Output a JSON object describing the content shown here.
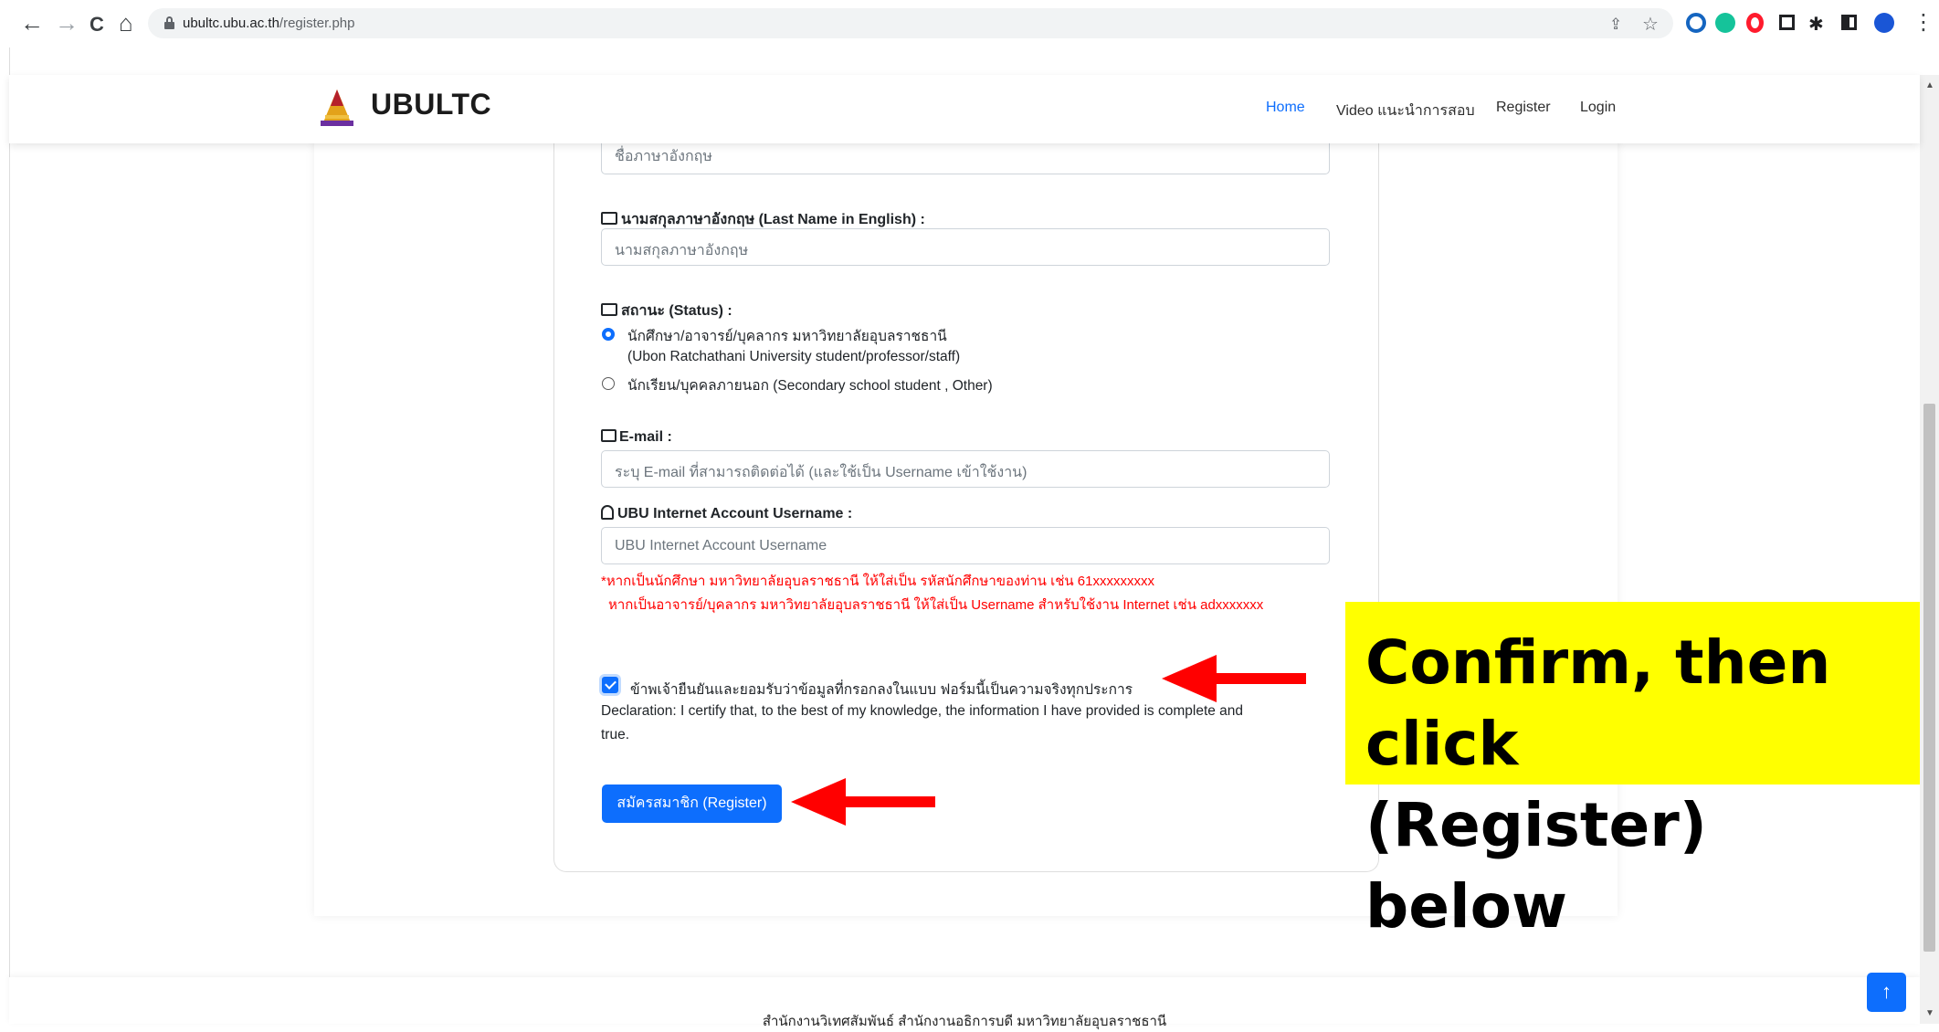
{
  "browser": {
    "url_host": "ubultc.ubu.ac.th",
    "url_path": "/register.php",
    "nav_back_icon": "←",
    "nav_forward_icon": "→",
    "nav_reload_icon": "C",
    "nav_home_icon": "⌂",
    "share_icon": "⇪",
    "star_icon": "☆",
    "menu_icon": "⋮"
  },
  "navbar": {
    "brand": "UBULTC",
    "links": {
      "home": "Home",
      "video": "Video แนะนำการสอบ",
      "register": "Register",
      "login": "Login"
    }
  },
  "form": {
    "first_name_en_placeholder": "ชื่อภาษาอังกฤษ",
    "last_name_en_label": "นามสกุลภาษาอังกฤษ (Last Name in English) :",
    "last_name_en_placeholder": "นามสกุลภาษาอังกฤษ",
    "status_label": "สถานะ (Status) :",
    "status_option_1_line1": "นักศึกษา/อาจารย์/บุคลากร มหาวิทยาลัยอุบลราชธานี",
    "status_option_1_line2": "(Ubon Ratchathani University student/professor/staff)",
    "status_option_2": "นักเรียน/บุคคลภายนอก (Secondary school student , Other)",
    "email_label": "E-mail :",
    "email_placeholder": "ระบุ E-mail ที่สามารถติดต่อได้ (และใช้เป็น Username เข้าใช้งาน)",
    "ubu_username_label": "UBU Internet Account Username :",
    "ubu_username_placeholder": "UBU Internet Account Username",
    "note_line1": "*หากเป็นนักศึกษา มหาวิทยาลัยอุบลราชธานี ให้ใส่เป็น รหัสนักศึกษาของท่าน เช่น 61xxxxxxxxx",
    "note_line2": "หากเป็นอาจารย์/บุคลากร มหาวิทยาลัยอุบลราชธานี ให้ใส่เป็น Username สำหรับใช้งาน Internet เช่น adxxxxxxx",
    "confirm_checkbox_label": "ข้าพเจ้ายืนยันและยอมรับว่าข้อมูลที่กรอกลงในแบบ ฟอร์มนี้เป็นความจริงทุกประการ",
    "declaration_line1": "Declaration: I certify that, to the best of my knowledge, the information I have provided is complete and",
    "declaration_line2": "true.",
    "register_button": "สมัครสมาชิก (Register)"
  },
  "annotation": {
    "line1": "Confirm, then click",
    "line2": "(Register) below"
  },
  "footer": {
    "text": "สำนักงานวิเทศสัมพันธ์ สำนักงานอธิการบดี มหาวิทยาลัยอุบลราชธานี",
    "scroll_top_icon": "↑"
  },
  "colors": {
    "primary": "#0d6efd",
    "warning_text": "#ff0000",
    "callout_bg": "#ffff00",
    "arrow": "#ff0000"
  }
}
